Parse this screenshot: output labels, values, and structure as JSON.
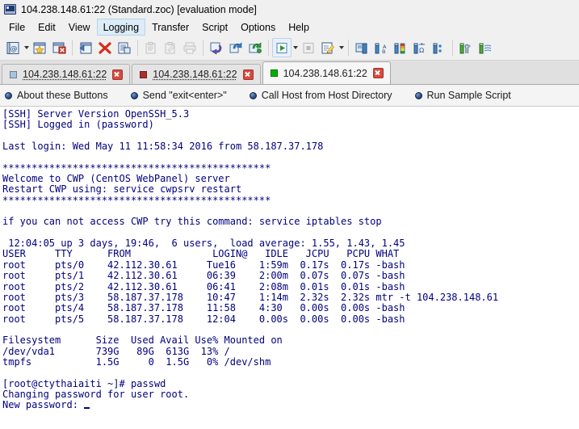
{
  "window": {
    "title": "104.238.148.61:22 (Standard.zoc) [evaluation mode]",
    "icon": "terminal-monitor-icon"
  },
  "menu": {
    "items": [
      {
        "label": "File",
        "active": false
      },
      {
        "label": "Edit",
        "active": false
      },
      {
        "label": "View",
        "active": false
      },
      {
        "label": "Logging",
        "active": true
      },
      {
        "label": "Transfer",
        "active": false
      },
      {
        "label": "Script",
        "active": false
      },
      {
        "label": "Options",
        "active": false
      },
      {
        "label": "Help",
        "active": false
      }
    ]
  },
  "toolbar": {
    "buttons": [
      {
        "name": "host-directory-icon",
        "kind": "book-at"
      },
      {
        "name": "toolbar-dropdown-caret-1",
        "kind": "caret"
      },
      {
        "name": "quick-connect-icon",
        "kind": "star-window"
      },
      {
        "name": "disconnect-icon",
        "kind": "window-close"
      },
      {
        "name": "separator-1",
        "kind": "sep"
      },
      {
        "name": "send-file-icon",
        "kind": "window-left"
      },
      {
        "name": "cancel-transfer-icon",
        "kind": "red-x"
      },
      {
        "name": "receive-file-icon",
        "kind": "doc-window"
      },
      {
        "name": "separator-2",
        "kind": "sep"
      },
      {
        "name": "paste-icon",
        "kind": "clipboard"
      },
      {
        "name": "copy-icon",
        "kind": "clipboard-pen"
      },
      {
        "name": "print-icon",
        "kind": "printer"
      },
      {
        "name": "separator-3",
        "kind": "sep"
      },
      {
        "name": "undo-arrow-icon",
        "kind": "arrow-purple"
      },
      {
        "name": "send-arrow-icon",
        "kind": "arrow-blue"
      },
      {
        "name": "run-arrow-icon",
        "kind": "arrow-green"
      },
      {
        "name": "separator-4",
        "kind": "sep"
      },
      {
        "name": "play-script-icon",
        "kind": "play"
      },
      {
        "name": "toolbar-dropdown-caret-2",
        "kind": "caret"
      },
      {
        "name": "stop-script-icon",
        "kind": "stop"
      },
      {
        "name": "edit-script-icon",
        "kind": "edit-pen"
      },
      {
        "name": "toolbar-dropdown-caret-3",
        "kind": "caret"
      },
      {
        "name": "separator-5",
        "kind": "sep"
      },
      {
        "name": "new-window-icon",
        "kind": "blue-window"
      },
      {
        "name": "font-settings-icon",
        "kind": "blue-ab"
      },
      {
        "name": "color-settings-icon",
        "kind": "blue-rainbow"
      },
      {
        "name": "emulation-settings-icon",
        "kind": "blue-omega"
      },
      {
        "name": "options-list-icon",
        "kind": "blue-list"
      },
      {
        "name": "separator-6",
        "kind": "sep"
      },
      {
        "name": "tools-icon",
        "kind": "green-tools"
      },
      {
        "name": "device-settings-icon",
        "kind": "green-device"
      }
    ]
  },
  "tabs": [
    {
      "label": "104.238.148.61:22",
      "color": "#a8c4e0",
      "active": false
    },
    {
      "label": "104.238.148.61:22",
      "color": "#a8322a",
      "active": false
    },
    {
      "label": "104.238.148.61:22",
      "color": "#00b000",
      "active": true
    }
  ],
  "button_bar": {
    "items": [
      {
        "label": "About these Buttons"
      },
      {
        "label": "Send \"exit<enter>\""
      },
      {
        "label": "Call Host from Host Directory"
      },
      {
        "label": "Run Sample Script"
      }
    ]
  },
  "terminal": {
    "foreground": "#00007f",
    "background": "#ffffff",
    "lines": [
      "[SSH] Server Version OpenSSH_5.3",
      "[SSH] Logged in (password)",
      "",
      "Last login: Wed May 11 11:58:34 2016 from 58.187.37.178",
      "",
      "**********************************************",
      "Welcome to CWP (CentOS WebPanel) server",
      "Restart CWP using: service cwpsrv restart",
      "**********************************************",
      "",
      "if you can not access CWP try this command: service iptables stop",
      "",
      " 12:04:05 up 3 days, 19:46,  6 users,  load average: 1.55, 1.43, 1.45",
      "USER     TTY      FROM              LOGIN@   IDLE   JCPU   PCPU WHAT",
      "root     pts/0    42.112.30.61     Tue16    1:59m  0.17s  0.17s -bash",
      "root     pts/1    42.112.30.61     06:39    2:00m  0.07s  0.07s -bash",
      "root     pts/2    42.112.30.61     06:41    2:08m  0.01s  0.01s -bash",
      "root     pts/3    58.187.37.178    10:47    1:14m  2.32s  2.32s mtr -t 104.238.148.61",
      "root     pts/4    58.187.37.178    11:58    4:30   0.00s  0.00s -bash",
      "root     pts/5    58.187.37.178    12:04    0.00s  0.00s  0.00s -bash",
      "",
      "Filesystem      Size  Used Avail Use% Mounted on",
      "/dev/vda1       739G   89G  613G  13% /",
      "tmpfs           1.5G     0  1.5G   0% /dev/shm",
      "",
      "[root@ctythaiaiti ~]# passwd",
      "Changing password for user root.",
      "New password: "
    ],
    "cursor_line_index": 27
  }
}
